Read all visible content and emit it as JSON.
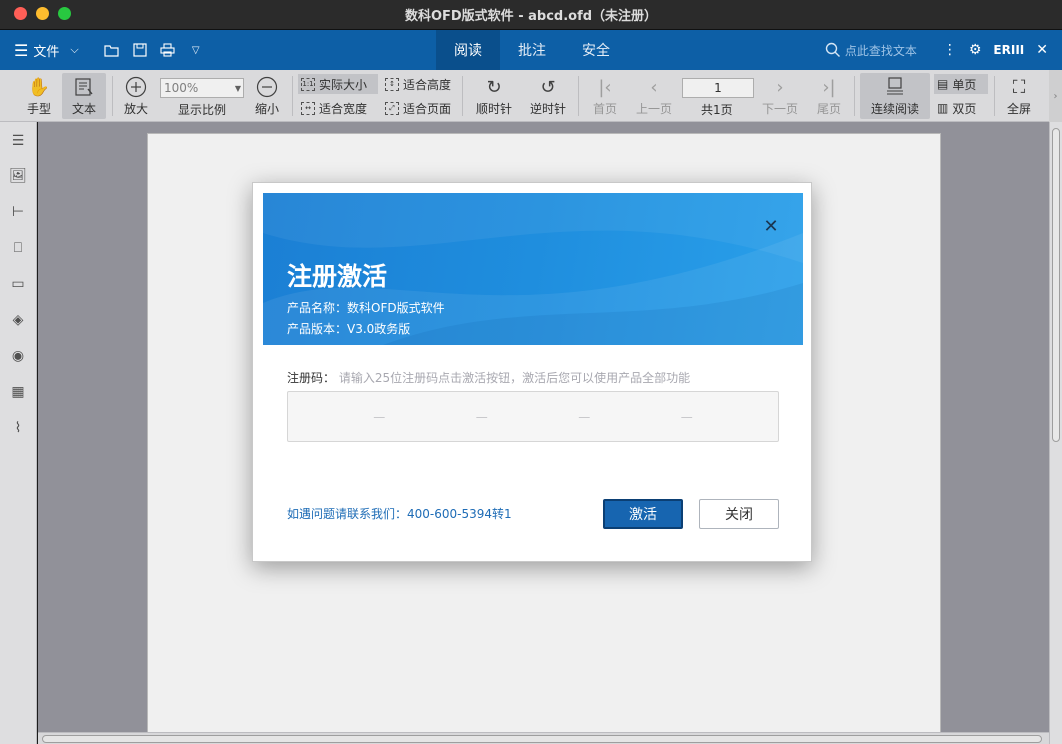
{
  "window": {
    "title": "数科OFD版式软件 - abcd.ofd（未注册）"
  },
  "menubar": {
    "file_label": "文件",
    "tabs": [
      {
        "label": "阅读",
        "active": true
      },
      {
        "label": "批注",
        "active": false
      },
      {
        "label": "安全",
        "active": false
      }
    ],
    "search_placeholder": "点此查找文本",
    "brand_label": "ERIII"
  },
  "toolbar": {
    "hand_label": "手型",
    "text_label": "文本",
    "zoom_in_label": "放大",
    "zoom_value": "100%",
    "zoom_label": "显示比例",
    "zoom_out_label": "缩小",
    "actual_size_label": "实际大小",
    "fit_height_label": "适合高度",
    "fit_width_label": "适合宽度",
    "fit_page_label": "适合页面",
    "rotate_cw_label": "顺时针",
    "rotate_ccw_label": "逆时针",
    "first_page_label": "首页",
    "prev_page_label": "上一页",
    "current_page": "1",
    "total_pages_label": "共1页",
    "next_page_label": "下一页",
    "last_page_label": "尾页",
    "continuous_label": "连续阅读",
    "single_label": "单页",
    "double_label": "双页",
    "fullscreen_label": "全屏"
  },
  "dialog": {
    "title": "注册激活",
    "product_name": "产品名称：数科OFD版式软件",
    "product_version": "产品版本：V3.0政务版",
    "reg_code_label": "注册码：",
    "reg_code_hint": "请输入25位注册码点击激活按钮，激活后您可以使用产品全部功能",
    "code_segments": [
      "—",
      "—",
      "—",
      "—"
    ],
    "contact": "如遇问题请联系我们：400-600-5394转1",
    "activate_label": "激活",
    "close_label": "关闭"
  },
  "colors": {
    "menubar": "#0d5fa6",
    "banner": "#1f8ede",
    "primary_button": "#1765b0"
  }
}
